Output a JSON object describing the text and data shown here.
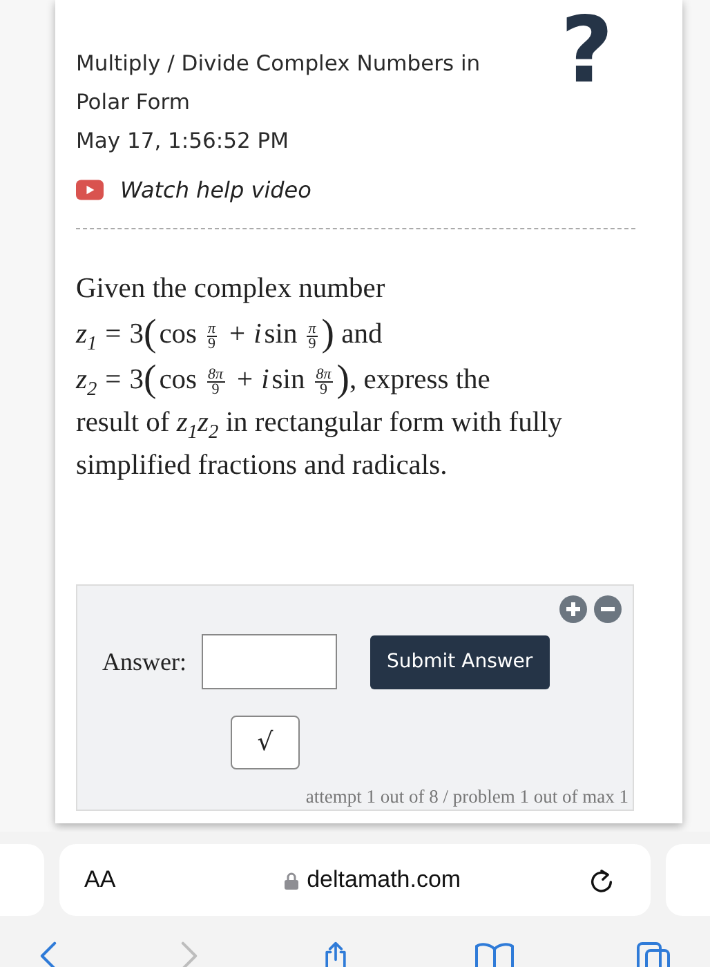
{
  "header": {
    "help_glyph": "?",
    "title": "Multiply / Divide Complex Numbers in Polar Form",
    "timestamp": "May 17, 1:56:52 PM",
    "video_link": "Watch help video"
  },
  "problem": {
    "lines": [
      [
        {
          "kind": "text",
          "text": "Given the complex number"
        }
      ],
      [
        {
          "kind": "var",
          "text": "z$_{1}$"
        },
        {
          "kind": "op",
          "text": "="
        },
        {
          "kind": "text",
          "text": "3"
        },
        {
          "kind": "paren",
          "text": "("
        },
        {
          "kind": "func",
          "text": "cos"
        },
        {
          "kind": "frac",
          "num": "π",
          "den": "9"
        },
        {
          "kind": "op",
          "text": "+"
        },
        {
          "kind": "var",
          "text": "i"
        },
        {
          "kind": "func",
          "text": "sin"
        },
        {
          "kind": "frac",
          "num": "π",
          "den": "9"
        },
        {
          "kind": "paren",
          "text": ")"
        },
        {
          "kind": "text",
          "text": " and"
        }
      ],
      [
        {
          "kind": "var",
          "text": "z$_{2}$"
        },
        {
          "kind": "op",
          "text": "="
        },
        {
          "kind": "text",
          "text": "3"
        },
        {
          "kind": "paren",
          "text": "("
        },
        {
          "kind": "func",
          "text": "cos"
        },
        {
          "kind": "frac",
          "num": "8π",
          "den": "9"
        },
        {
          "kind": "op",
          "text": "+"
        },
        {
          "kind": "var",
          "text": "i"
        },
        {
          "kind": "func",
          "text": "sin"
        },
        {
          "kind": "frac",
          "num": "8π",
          "den": "9"
        },
        {
          "kind": "paren",
          "text": ")"
        },
        {
          "kind": "text",
          "text": ", express the"
        }
      ],
      [
        {
          "kind": "text",
          "text": "result of "
        },
        {
          "kind": "var",
          "text": "z$_{1}$z$_{2}$"
        },
        {
          "kind": "text",
          "text": " in rectangular form with fully simplified fractions and radicals."
        }
      ]
    ]
  },
  "answer_panel": {
    "label": "Answer:",
    "submit_button": "Submit Answer",
    "sqrt_button": "√",
    "attempt_text": "attempt 1 out of 8 / problem 1 out of max 1"
  },
  "browser": {
    "text_size_button": "AA",
    "url": "deltamath.com",
    "forward_disabled": true
  }
}
